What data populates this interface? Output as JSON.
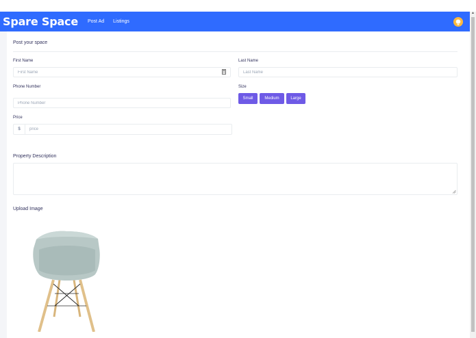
{
  "navbar": {
    "brand": "Spare Space",
    "links": [
      "Post Ad",
      "Listings"
    ],
    "avatar_icon": "lightbulb-icon",
    "color": "#2f6bff"
  },
  "form": {
    "title": "Post your space",
    "first_name": {
      "label": "First Name",
      "placeholder": "First Name"
    },
    "last_name": {
      "label": "Last Name",
      "placeholder": "Last Name"
    },
    "phone": {
      "label": "Phone Number",
      "placeholder": "Phone Number"
    },
    "size": {
      "label": "Size",
      "options": [
        "Small",
        "Medium",
        "Large"
      ]
    },
    "price": {
      "label": "Price",
      "currency": "$",
      "placeholder": "price"
    },
    "description": {
      "label": "Property Description",
      "value": ""
    },
    "upload": {
      "label": "Upload Image"
    }
  },
  "colors": {
    "accent": "#6e5ae6",
    "nav": "#2f6bff",
    "avatar": "#ffb93d"
  }
}
